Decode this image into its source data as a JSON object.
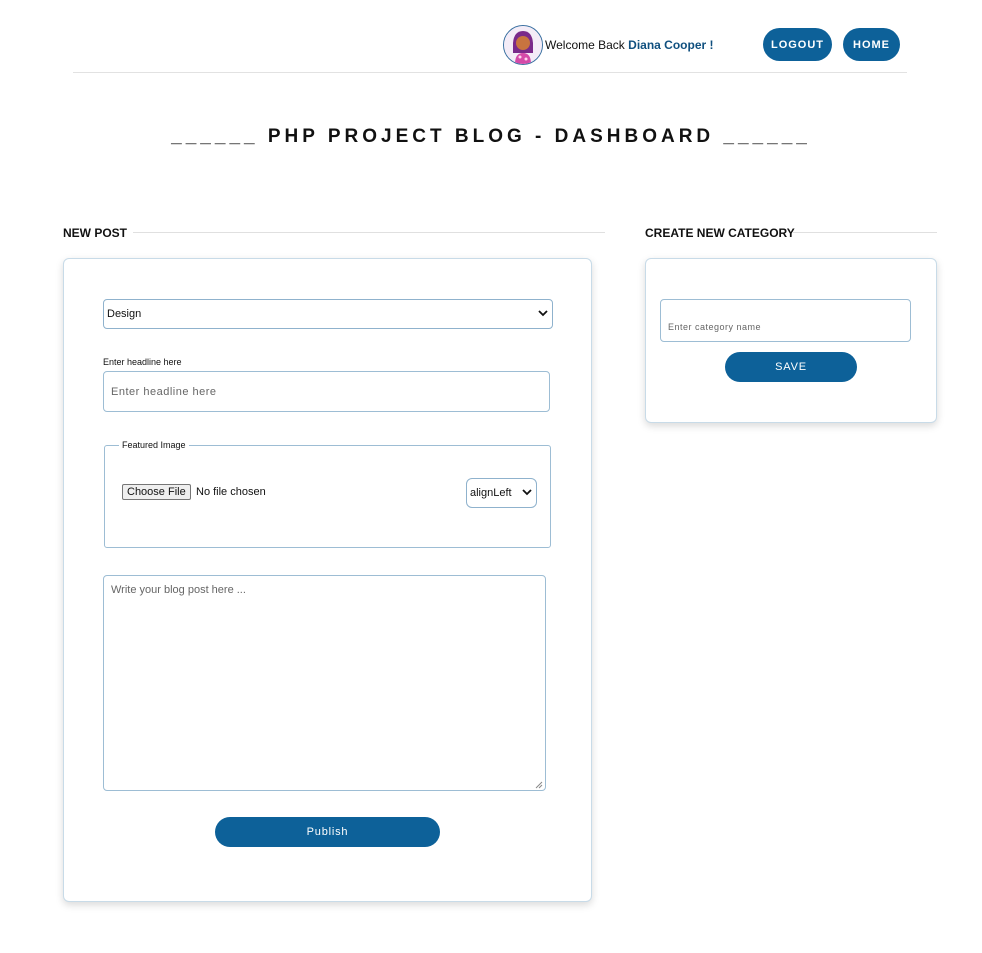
{
  "header": {
    "welcome_text": "Welcome Back",
    "user_name": "Diana Cooper !",
    "logout_label": "LOGOUT",
    "home_label": "HOME"
  },
  "page": {
    "title": "______ PHP PROJECT BLOG - DASHBOARD ______"
  },
  "new_post": {
    "section_label": "NEW POST",
    "category_select": {
      "selected": "Design"
    },
    "headline_label": "Enter headline here",
    "headline_placeholder": "Enter headline here",
    "featured_image": {
      "legend": "Featured Image",
      "choose_file_label": "Choose File",
      "file_status": "No file chosen",
      "align_select": {
        "selected": "alignLeft"
      }
    },
    "body_placeholder": "Write your blog post here ...",
    "publish_label": "Publish"
  },
  "new_category": {
    "section_label": "CREATE NEW CATEGORY",
    "name_placeholder": "Enter category name",
    "save_label": "SAVE"
  },
  "colors": {
    "primary": "#0d6199",
    "username": "#10507f",
    "field_border": "#9dbdd4"
  },
  "icons": {
    "avatar": "user-avatar-illustration",
    "select_arrow": "chevron-down-icon",
    "resize_handle": "resize-grip-icon"
  }
}
